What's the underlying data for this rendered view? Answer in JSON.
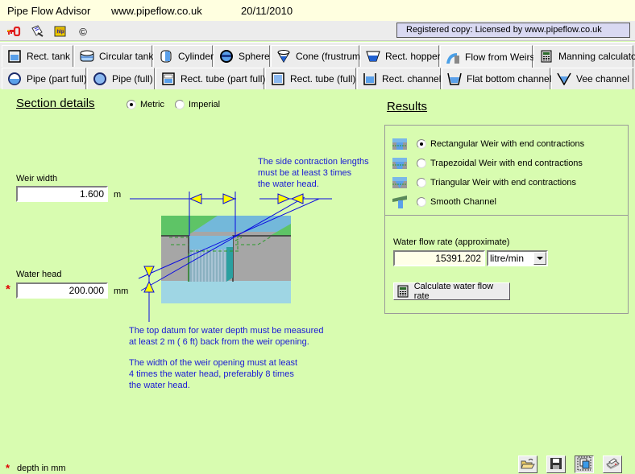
{
  "titlebar": {
    "app_name": "Pipe Flow Advisor",
    "website": "www.pipeflow.co.uk",
    "date": "20/11/2010"
  },
  "toolbar": {
    "icons": [
      "key-icon",
      "notepad-icon",
      "help-book-icon",
      "copyright-icon"
    ],
    "copyright_glyph": "©",
    "registered_text": "Registered copy: Licensed by www.pipeflow.co.uk"
  },
  "tabs": {
    "row1": [
      {
        "label": "Rect. tank",
        "icon": "rect-tank-icon"
      },
      {
        "label": "Circular tank",
        "icon": "circular-tank-icon"
      },
      {
        "label": "Cylinder",
        "icon": "cylinder-icon"
      },
      {
        "label": "Sphere",
        "icon": "sphere-icon"
      },
      {
        "label": "Cone (frustrum)",
        "icon": "cone-icon"
      },
      {
        "label": "Rect. hopper",
        "icon": "rect-hopper-icon"
      },
      {
        "label": "Flow from Weirs",
        "icon": "weir-icon",
        "active": true
      },
      {
        "label": "Manning calculator",
        "icon": "calculator-icon"
      }
    ],
    "row2": [
      {
        "label": "Pipe (part full)",
        "icon": "pipe-part-full-icon"
      },
      {
        "label": "Pipe (full)",
        "icon": "pipe-full-icon"
      },
      {
        "label": "Rect. tube (part full)",
        "icon": "rect-tube-part-full-icon"
      },
      {
        "label": "Rect. tube (full)",
        "icon": "rect-tube-full-icon"
      },
      {
        "label": "Rect. channel",
        "icon": "rect-channel-icon"
      },
      {
        "label": "Flat bottom channel",
        "icon": "flat-bottom-channel-icon"
      },
      {
        "label": "Vee channel",
        "icon": "vee-channel-icon"
      }
    ]
  },
  "section": {
    "title": "Section details",
    "units": {
      "metric": "Metric",
      "imperial": "Imperial",
      "selected": "Metric"
    },
    "weir_width": {
      "label": "Weir width",
      "value": "1.600",
      "unit": "m"
    },
    "water_head": {
      "label": "Water head",
      "value": "200.000",
      "unit": "mm",
      "required_marker": "*"
    },
    "notes": {
      "side_contraction": [
        "The side contraction lengths",
        "must be at least 3 times",
        "the water head."
      ],
      "top_datum": [
        "The top datum for water depth must be measured",
        "at least 2 m ( 6 ft) back from the weir opening."
      ],
      "weir_width": [
        "The width of the weir opening must at least",
        "4 times the water head, preferably 8 times",
        "the water head."
      ]
    }
  },
  "results": {
    "title": "Results",
    "weir_types": [
      {
        "label": "Rectangular Weir with end contractions",
        "selected": true
      },
      {
        "label": "Trapezoidal Weir with end contractions",
        "selected": false
      },
      {
        "label": "Triangular Weir with end contractions",
        "selected": false
      },
      {
        "label": "Smooth Channel",
        "selected": false
      }
    ],
    "flow_rate": {
      "label": "Water flow rate (approximate)",
      "value": "15391.202",
      "unit": "litre/min"
    },
    "calculate_label": "Calculate water flow rate"
  },
  "footer": {
    "note_marker": "*",
    "note": "depth in mm",
    "buttons": [
      "open-folder-icon",
      "save-disk-icon",
      "copy-icon",
      "print-icon"
    ]
  }
}
